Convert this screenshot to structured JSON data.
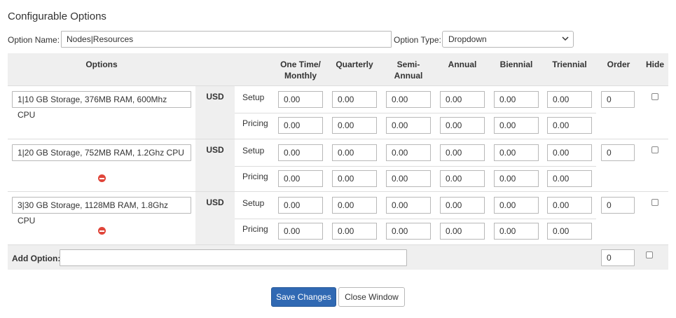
{
  "title": "Configurable Options",
  "option_name": {
    "label": "Option Name:",
    "value": "Nodes|Resources"
  },
  "option_type": {
    "label": "Option Type:",
    "value": "Dropdown"
  },
  "headers": {
    "options": "Options",
    "one_time_line1": "One Time/",
    "one_time_line2": "Monthly",
    "quarterly": "Quarterly",
    "semi_line1": "Semi-",
    "semi_line2": "Annual",
    "annual": "Annual",
    "biennial": "Biennial",
    "triennial": "Triennial",
    "order": "Order",
    "hide": "Hide"
  },
  "row_labels": {
    "currency": "USD",
    "setup": "Setup",
    "pricing": "Pricing"
  },
  "options": [
    {
      "name": "1|10 GB Storage, 376MB RAM, 600Mhz CPU",
      "order": "0",
      "removable": false,
      "setup": [
        "0.00",
        "0.00",
        "0.00",
        "0.00",
        "0.00",
        "0.00"
      ],
      "pricing": [
        "0.00",
        "0.00",
        "0.00",
        "0.00",
        "0.00",
        "0.00"
      ]
    },
    {
      "name": "1|20 GB Storage, 752MB RAM, 1.2Ghz CPU",
      "order": "0",
      "removable": true,
      "setup": [
        "0.00",
        "0.00",
        "0.00",
        "0.00",
        "0.00",
        "0.00"
      ],
      "pricing": [
        "0.00",
        "0.00",
        "0.00",
        "0.00",
        "0.00",
        "0.00"
      ]
    },
    {
      "name": "3|30 GB Storage, 1128MB RAM, 1.8Ghz CPU",
      "order": "0",
      "removable": true,
      "setup": [
        "0.00",
        "0.00",
        "0.00",
        "0.00",
        "0.00",
        "0.00"
      ],
      "pricing": [
        "0.00",
        "0.00",
        "0.00",
        "0.00",
        "0.00",
        "0.00"
      ]
    }
  ],
  "add_option": {
    "label": "Add Option:",
    "value": "",
    "order": "0"
  },
  "buttons": {
    "save": "Save Changes",
    "close": "Close Window"
  },
  "colors": {
    "primary": "#3069b3",
    "header_bg": "#efefef",
    "remove": "#e0453a"
  }
}
